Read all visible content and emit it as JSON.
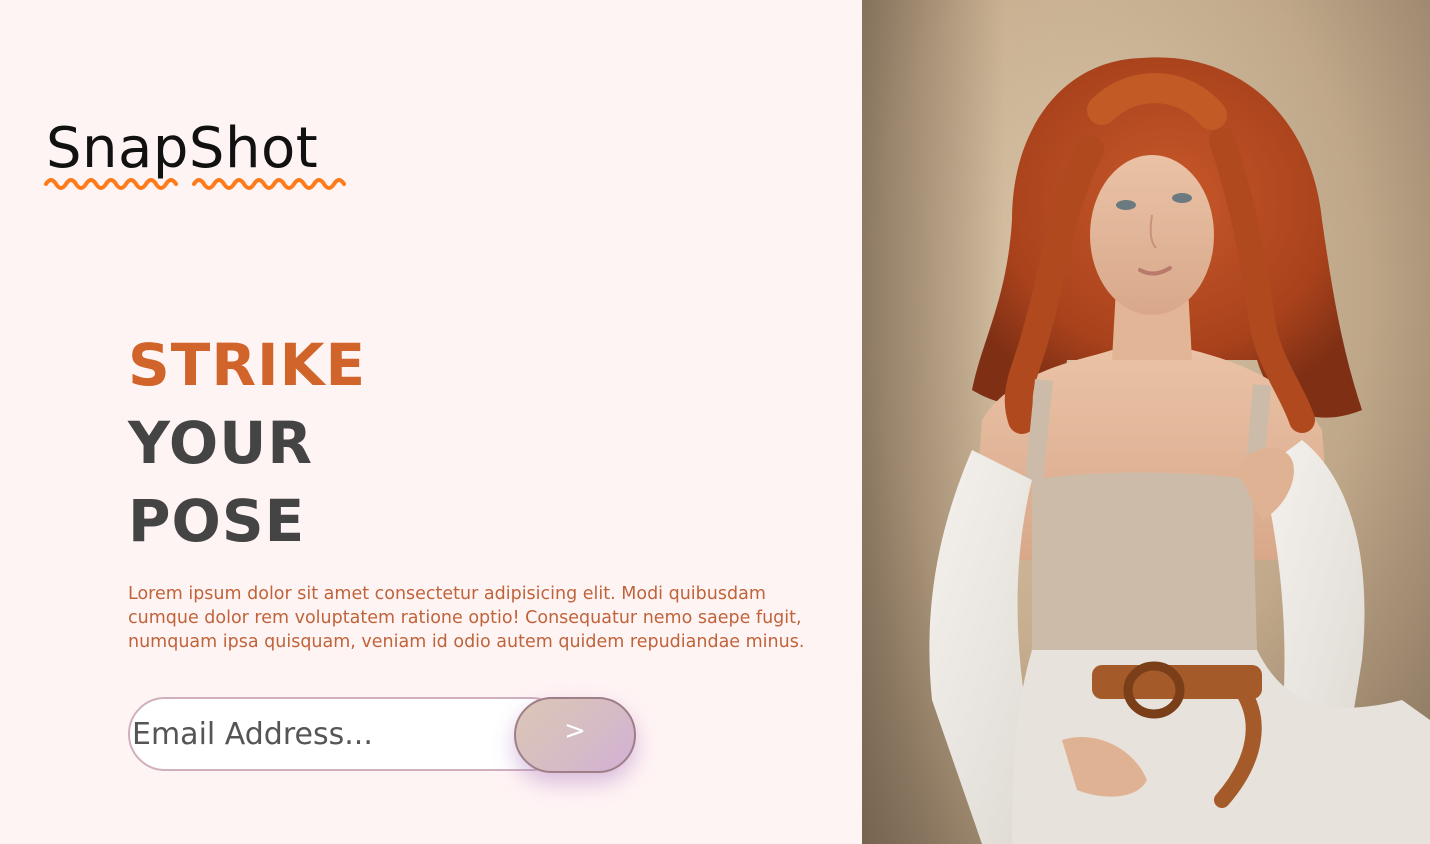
{
  "brand": {
    "name": "SnapShot",
    "wave_color": "#ff7a1a"
  },
  "hero": {
    "headline_line1": "STRIKE",
    "headline_line2": "YOUR",
    "headline_line3": "POSE",
    "description": "Lorem ipsum dolor sit amet consectetur adipisicing elit. Modi quibusdam cumque dolor rem voluptatem ratione optio! Consequatur nemo saepe fugit, numquam ipsa quisquam, veniam id odio autem quidem repudiandae minus."
  },
  "subscribe": {
    "email_placeholder": "Email Address...",
    "email_value": "",
    "submit_label": ">"
  },
  "colors": {
    "background": "#fff4f4",
    "accent": "#d0642a",
    "heading_dark": "#444444",
    "body_text": "#c0633a"
  },
  "hero_image": {
    "icon": "portrait-photo"
  }
}
